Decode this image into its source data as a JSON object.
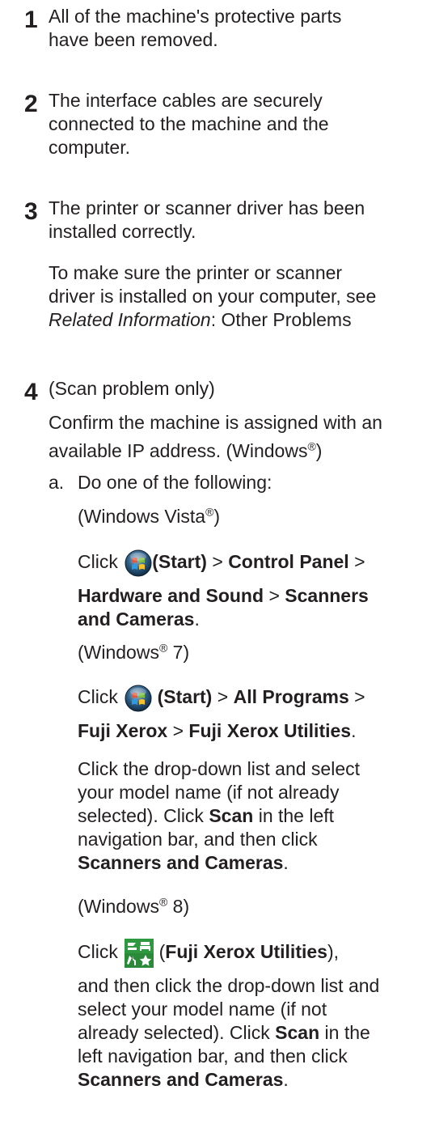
{
  "steps": [
    {
      "num": "1",
      "lines": [
        "All of the machine's protective parts",
        "have been removed."
      ]
    },
    {
      "num": "2",
      "lines": [
        "The interface cables are securely",
        "connected to the machine and the",
        "computer."
      ]
    },
    {
      "num": "3",
      "lines": [
        "The printer or scanner driver has been",
        "installed correctly."
      ],
      "note_lines": [
        "To make sure the printer or scanner",
        "driver is installed on your computer, see"
      ],
      "note_ref_italic": "Related Information",
      "note_ref_rest": ": Other Problems"
    },
    {
      "num": "4",
      "lines": [
        "(Scan problem only)"
      ],
      "confirm_line1": "Confirm the machine is assigned with an",
      "confirm_line2_pre": "available IP address. (Windows",
      "reg": "®",
      "confirm_line2_post": ")"
    }
  ],
  "substep_a": {
    "letter": "a.",
    "intro": "Do one of the following:",
    "vista_label_pre": "(Windows Vista",
    "vista_label_post": ")",
    "vista_click": "Click",
    "vista_start": "(Start)",
    "sep": ">",
    "vista_control_panel": "Control Panel",
    "vista_hw_sound": "Hardware and Sound",
    "vista_scanners": "Scanners",
    "vista_and_cameras": "and Cameras",
    "period": ".",
    "win7_label_pre": "(Windows",
    "win7_label_post": " 7)",
    "win7_click": "Click",
    "win7_start": "(Start)",
    "win7_all_programs": "All Programs",
    "win7_fuji_xerox": "Fuji Xerox",
    "win7_utilities": "Fuji Xerox Utilities",
    "dropdown_lines": [
      "Click the drop-down list and select",
      "your model name (if not already",
      "selected). Click "
    ],
    "scan": "Scan",
    "left_nav_rest": " in the left",
    "nav_line": "navigation bar, and then click",
    "scanners_and_cameras": "Scanners and Cameras",
    "win8_label_pre": "(Windows",
    "win8_label_post": " 8)",
    "win8_click": "Click",
    "win8_utilities_open": "(",
    "win8_utilities": "Fuji Xerox Utilities",
    "win8_utilities_close": "),",
    "win8_lines": [
      "and then click the drop-down list and",
      "select your model name (if not",
      "already selected). Click "
    ],
    "win8_left_rest": " in the",
    "win8_nav_line": "left navigation bar, and then click"
  }
}
